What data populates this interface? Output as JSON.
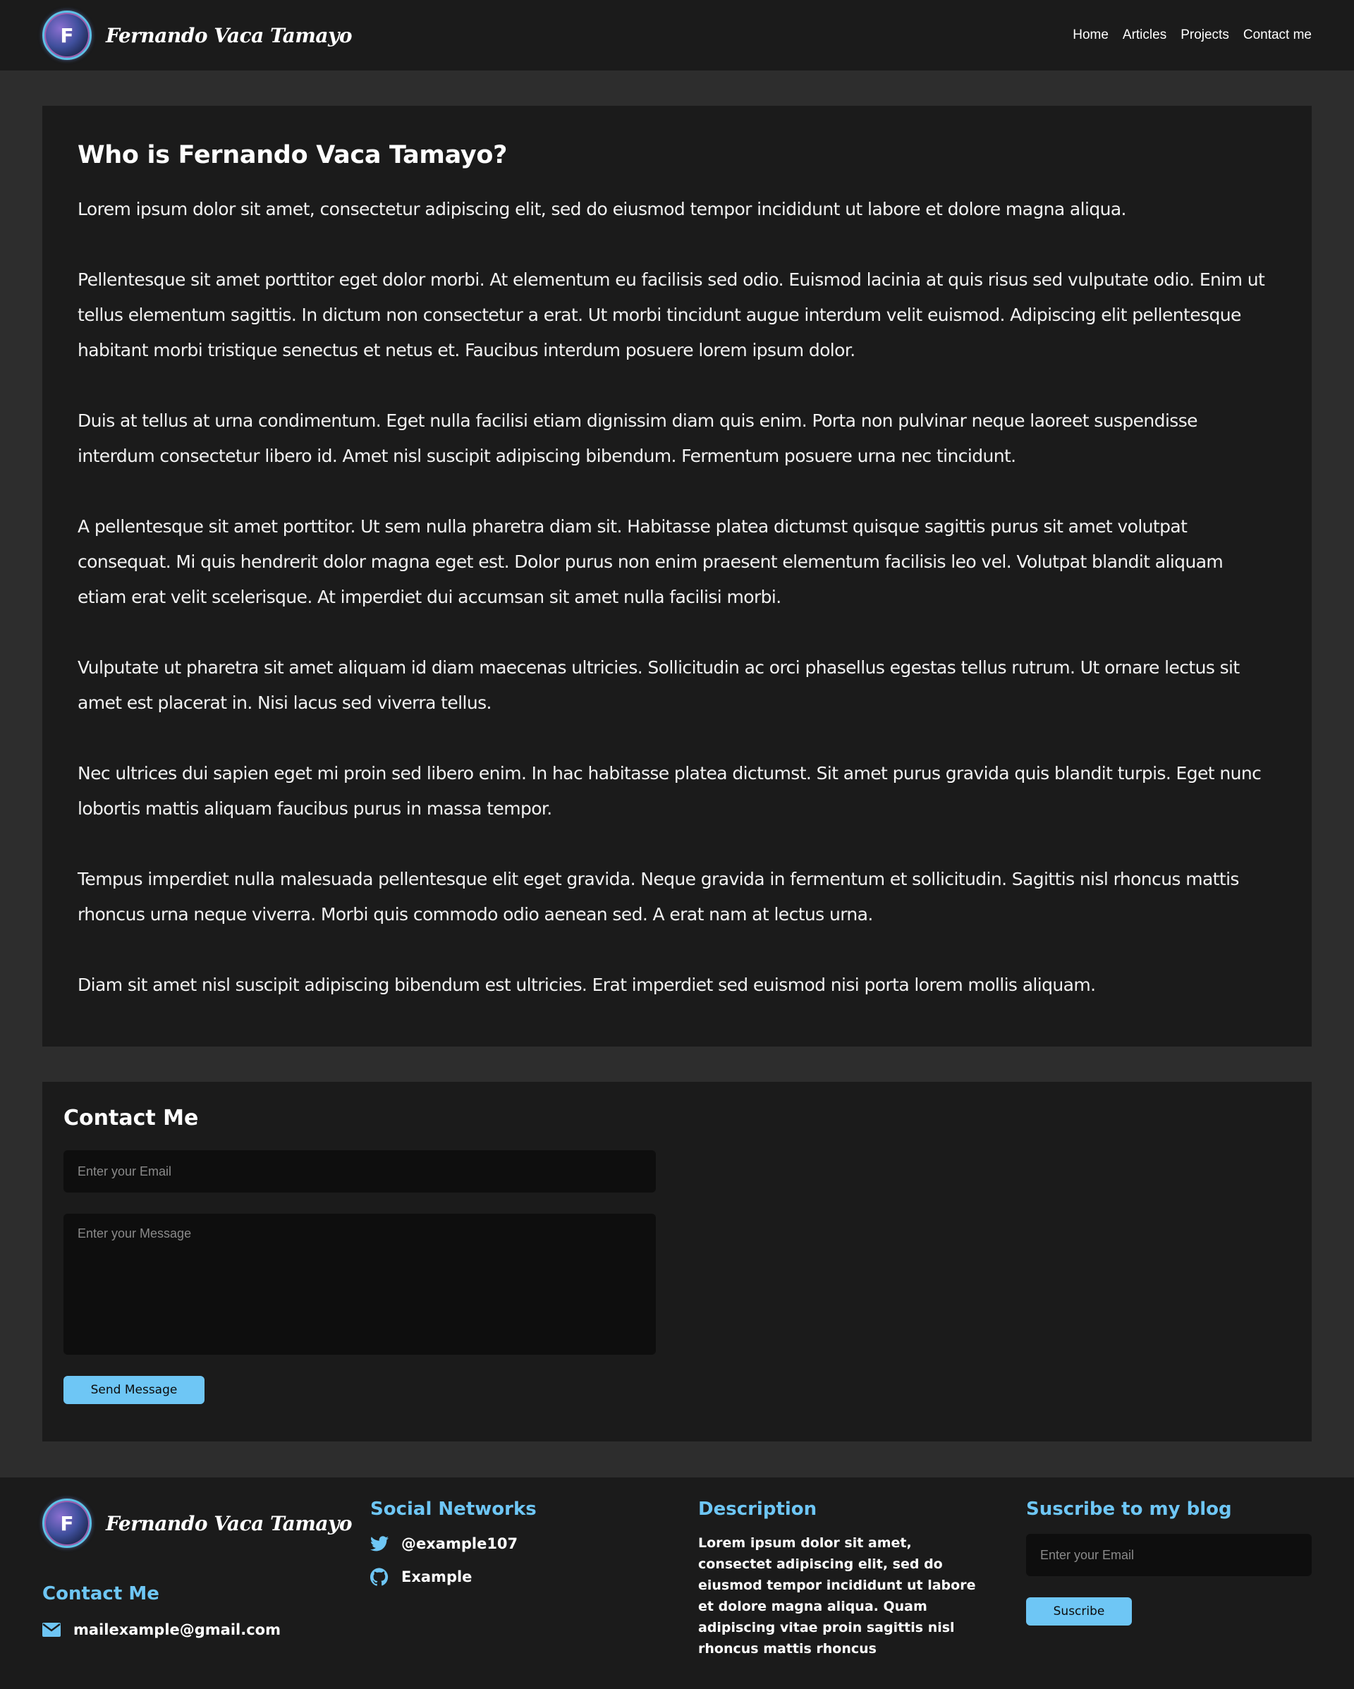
{
  "header": {
    "logo_letter": "F",
    "brand_name": "Fernando Vaca Tamayo",
    "nav": [
      "Home",
      "Articles",
      "Projects",
      "Contact me"
    ]
  },
  "about": {
    "title": "Who is Fernando Vaca Tamayo?",
    "paragraphs": [
      "Lorem ipsum dolor sit amet, consectetur adipiscing elit, sed do eiusmod tempor incididunt ut labore et dolore magna aliqua.",
      "Pellentesque sit amet porttitor eget dolor morbi. At elementum eu facilisis sed odio. Euismod lacinia at quis risus sed vulputate odio. Enim ut tellus elementum sagittis. In dictum non consectetur a erat. Ut morbi tincidunt augue interdum velit euismod. Adipiscing elit pellentesque habitant morbi tristique senectus et netus et. Faucibus interdum posuere lorem ipsum dolor.",
      "Duis at tellus at urna condimentum. Eget nulla facilisi etiam dignissim diam quis enim. Porta non pulvinar neque laoreet suspendisse interdum consectetur libero id. Amet nisl suscipit adipiscing bibendum. Fermentum posuere urna nec tincidunt.",
      "A pellentesque sit amet porttitor. Ut sem nulla pharetra diam sit. Habitasse platea dictumst quisque sagittis purus sit amet volutpat consequat. Mi quis hendrerit dolor magna eget est. Dolor purus non enim praesent elementum facilisis leo vel. Volutpat blandit aliquam etiam erat velit scelerisque. At imperdiet dui accumsan sit amet nulla facilisi morbi.",
      "Vulputate ut pharetra sit amet aliquam id diam maecenas ultricies. Sollicitudin ac orci phasellus egestas tellus rutrum. Ut ornare lectus sit amet est placerat in. Nisi lacus sed viverra tellus.",
      "Nec ultrices dui sapien eget mi proin sed libero enim. In hac habitasse platea dictumst. Sit amet purus gravida quis blandit turpis. Eget nunc lobortis mattis aliquam faucibus purus in massa tempor.",
      "Tempus imperdiet nulla malesuada pellentesque elit eget gravida. Neque gravida in fermentum et sollicitudin. Sagittis nisl rhoncus mattis rhoncus urna neque viverra. Morbi quis commodo odio aenean sed. A erat nam at lectus urna.",
      "Diam sit amet nisl suscipit adipiscing bibendum est ultricies. Erat imperdiet sed euismod nisi porta lorem mollis aliquam."
    ]
  },
  "contact": {
    "title": "Contact Me",
    "email_value": "",
    "email_placeholder": "Enter your Email",
    "message_value": "",
    "message_placeholder": "Enter your Message",
    "send_label": "Send Message"
  },
  "footer": {
    "brand_name": "Fernando Vaca Tamayo",
    "logo_letter": "F",
    "contact_title": "Contact Me",
    "email": "mailexample@gmail.com",
    "social_title": "Social Networks",
    "twitter_handle": "@example107",
    "github_name": "Example",
    "description_title": "Description",
    "description_text": "Lorem ipsum dolor sit amet, consectet adipiscing elit, sed do eiusmod tempor incididunt ut labore et dolore magna aliqua. Quam adipiscing vitae proin sagittis nisl rhoncus mattis rhoncus",
    "subscribe_title": "Suscribe to my blog",
    "subscribe_placeholder": "Enter your Email",
    "subscribe_label": "Suscribe"
  },
  "colors": {
    "background": "#2d2d2d",
    "panel": "#1b1b1b",
    "accent": "#6ec6f5",
    "input_bg": "#0e0e0e"
  },
  "icons": {
    "twitter": "twitter-icon",
    "github": "github-icon",
    "mail": "mail-icon"
  }
}
